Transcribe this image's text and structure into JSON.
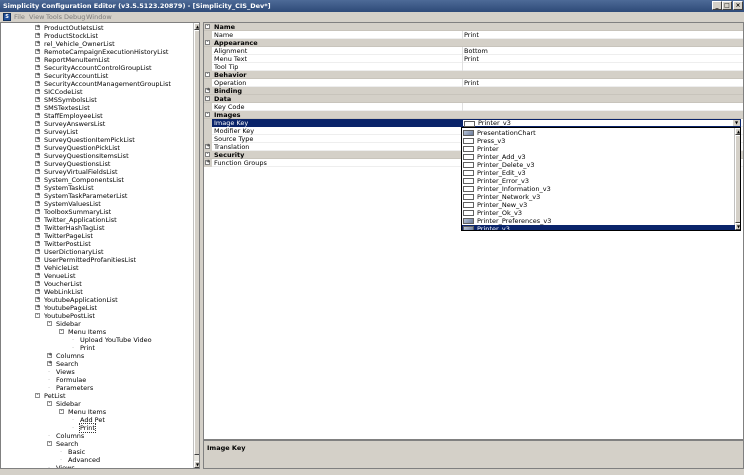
{
  "window": {
    "title": "Simplicity Configuration Editor (v3.5.5123.20879) - [Simplicity_CIS_Dev*]"
  },
  "menu": [
    "File",
    "View",
    "Tools",
    "Debug",
    "Window"
  ],
  "tree": [
    {
      "label": "ProductOutletsList",
      "indent": 0,
      "exp": "+"
    },
    {
      "label": "ProductStockList",
      "indent": 0,
      "exp": "+"
    },
    {
      "label": "rel_Vehicle_OwnerList",
      "indent": 0,
      "exp": "+"
    },
    {
      "label": "RemoteCampaignExecutionHistoryList",
      "indent": 0,
      "exp": "+"
    },
    {
      "label": "ReportMenuItemList",
      "indent": 0,
      "exp": "+"
    },
    {
      "label": "SecurityAccountControlGroupList",
      "indent": 0,
      "exp": "+"
    },
    {
      "label": "SecurityAccountList",
      "indent": 0,
      "exp": "+"
    },
    {
      "label": "SecurityAccountManagementGroupList",
      "indent": 0,
      "exp": "+"
    },
    {
      "label": "SICCodeList",
      "indent": 0,
      "exp": "+"
    },
    {
      "label": "SMSSymbolsList",
      "indent": 0,
      "exp": "+"
    },
    {
      "label": "SMSTextesList",
      "indent": 0,
      "exp": "+"
    },
    {
      "label": "StaffEmployeeList",
      "indent": 0,
      "exp": "+"
    },
    {
      "label": "SurveyAnswersList",
      "indent": 0,
      "exp": "+"
    },
    {
      "label": "SurveyList",
      "indent": 0,
      "exp": "+"
    },
    {
      "label": "SurveyQuestionItemPickList",
      "indent": 0,
      "exp": "+"
    },
    {
      "label": "SurveyQuestionPickList",
      "indent": 0,
      "exp": "+"
    },
    {
      "label": "SurveyQuestionsItemsList",
      "indent": 0,
      "exp": "+"
    },
    {
      "label": "SurveyQuestionsList",
      "indent": 0,
      "exp": "+"
    },
    {
      "label": "SurveyVirtualFieldsList",
      "indent": 0,
      "exp": "+"
    },
    {
      "label": "System_ComponentsList",
      "indent": 0,
      "exp": "+"
    },
    {
      "label": "SystemTaskList",
      "indent": 0,
      "exp": "+"
    },
    {
      "label": "SystemTaskParameterList",
      "indent": 0,
      "exp": "+"
    },
    {
      "label": "SystemValuesList",
      "indent": 0,
      "exp": "+"
    },
    {
      "label": "ToolboxSummaryList",
      "indent": 0,
      "exp": "+"
    },
    {
      "label": "Twitter_ApplicationList",
      "indent": 0,
      "exp": "+"
    },
    {
      "label": "TwitterHashTagList",
      "indent": 0,
      "exp": "+"
    },
    {
      "label": "TwitterPageList",
      "indent": 0,
      "exp": "+"
    },
    {
      "label": "TwitterPostList",
      "indent": 0,
      "exp": "+"
    },
    {
      "label": "UserDictionaryList",
      "indent": 0,
      "exp": "+"
    },
    {
      "label": "UserPermittedProfanitiesList",
      "indent": 0,
      "exp": "+"
    },
    {
      "label": "VehicleList",
      "indent": 0,
      "exp": "+"
    },
    {
      "label": "VenueList",
      "indent": 0,
      "exp": "+"
    },
    {
      "label": "VoucherList",
      "indent": 0,
      "exp": "+"
    },
    {
      "label": "WebLinkList",
      "indent": 0,
      "exp": "+"
    },
    {
      "label": "YoutubeApplicationList",
      "indent": 0,
      "exp": "+"
    },
    {
      "label": "YoutubePageList",
      "indent": 0,
      "exp": "+"
    },
    {
      "label": "YoutubePostList",
      "indent": 0,
      "exp": "-"
    },
    {
      "label": "Sidebar",
      "indent": 1,
      "exp": "-"
    },
    {
      "label": "Menu Items",
      "indent": 2,
      "exp": "-"
    },
    {
      "label": "Upload YouTube Video",
      "indent": 3,
      "exp": ""
    },
    {
      "label": "Print",
      "indent": 3,
      "exp": ""
    },
    {
      "label": "Columns",
      "indent": 1,
      "exp": "+"
    },
    {
      "label": "Search",
      "indent": 1,
      "exp": "+"
    },
    {
      "label": "Views",
      "indent": 1,
      "exp": ""
    },
    {
      "label": "Formulae",
      "indent": 1,
      "exp": ""
    },
    {
      "label": "Parameters",
      "indent": 1,
      "exp": ""
    },
    {
      "label": "PetList",
      "indent": 0,
      "exp": "-"
    },
    {
      "label": "Sidebar",
      "indent": 1,
      "exp": "-"
    },
    {
      "label": "Menu Items",
      "indent": 2,
      "exp": "-"
    },
    {
      "label": "Add Pet",
      "indent": 3,
      "exp": ""
    },
    {
      "label": "Print",
      "indent": 3,
      "exp": "",
      "selected": true
    },
    {
      "label": "Columns",
      "indent": 1,
      "exp": ""
    },
    {
      "label": "Search",
      "indent": 1,
      "exp": "-"
    },
    {
      "label": "Basic",
      "indent": 2,
      "exp": ""
    },
    {
      "label": "Advanced",
      "indent": 2,
      "exp": ""
    },
    {
      "label": "Views",
      "indent": 1,
      "exp": ""
    }
  ],
  "properties": [
    {
      "type": "cat",
      "name": "Name",
      "exp": "-"
    },
    {
      "type": "prop",
      "name": "Name",
      "value": "Print"
    },
    {
      "type": "cat",
      "name": "Appearance",
      "exp": "-"
    },
    {
      "type": "prop",
      "name": "Alignment",
      "value": "Bottom"
    },
    {
      "type": "prop",
      "name": "Menu Text",
      "value": "Print"
    },
    {
      "type": "prop",
      "name": "Tool Tip",
      "value": ""
    },
    {
      "type": "cat",
      "name": "Behavior",
      "exp": "-"
    },
    {
      "type": "prop",
      "name": "Operation",
      "value": "Print"
    },
    {
      "type": "cat",
      "name": "Binding",
      "exp": "+"
    },
    {
      "type": "cat",
      "name": "Data",
      "exp": "-"
    },
    {
      "type": "prop",
      "name": "Key Code",
      "value": ""
    },
    {
      "type": "cat",
      "name": "Images",
      "exp": "-"
    },
    {
      "type": "prop",
      "name": "Image Key",
      "value": "",
      "selected": true
    },
    {
      "type": "prop",
      "name": "Modifier Key",
      "value": ""
    },
    {
      "type": "prop",
      "name": "Source Type",
      "value": ""
    },
    {
      "type": "prop",
      "name": "Translation",
      "value": "",
      "exp": "+"
    },
    {
      "type": "cat",
      "name": "Security",
      "exp": "-"
    },
    {
      "type": "prop",
      "name": "Function Groups",
      "value": "",
      "exp": "+"
    }
  ],
  "combo": {
    "value": "Printer_v3"
  },
  "dropdown": [
    {
      "label": "PresentationChart",
      "img": true
    },
    {
      "label": "Press_v3",
      "img": false
    },
    {
      "label": "Printer",
      "img": false
    },
    {
      "label": "Printer_Add_v3",
      "img": false
    },
    {
      "label": "Printer_Delete_v3",
      "img": false
    },
    {
      "label": "Printer_Edit_v3",
      "img": false
    },
    {
      "label": "Printer_Error_v3",
      "img": false
    },
    {
      "label": "Printer_Information_v3",
      "img": false
    },
    {
      "label": "Printer_Network_v3",
      "img": false
    },
    {
      "label": "Printer_New_v3",
      "img": false
    },
    {
      "label": "Printer_Ok_v3",
      "img": false
    },
    {
      "label": "Printer_Preferences_v3",
      "img": true
    },
    {
      "label": "Printer_v3",
      "img": true,
      "selected": true
    }
  ],
  "description": {
    "title": "Image Key"
  }
}
